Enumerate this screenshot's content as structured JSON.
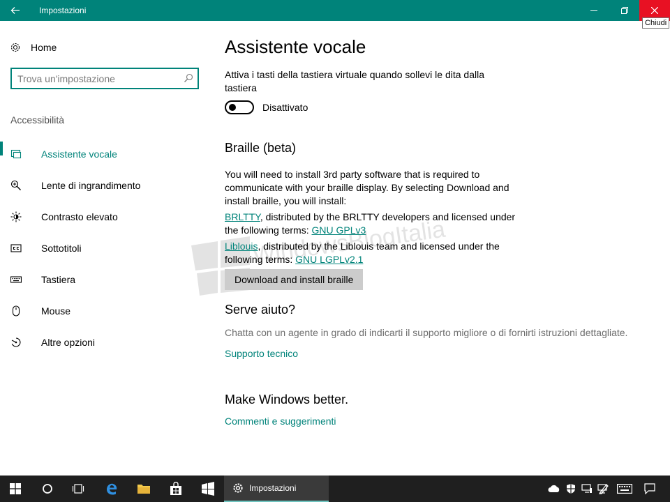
{
  "window": {
    "title": "Impostazioni",
    "close_tooltip": "Chiudi"
  },
  "nav": {
    "home_label": "Home",
    "search_placeholder": "Trova un'impostazione",
    "section_label": "Accessibilità",
    "items": [
      {
        "label": "Assistente vocale",
        "icon": "narrator-icon",
        "active": true
      },
      {
        "label": "Lente di ingrandimento",
        "icon": "magnifier-icon"
      },
      {
        "label": "Contrasto elevato",
        "icon": "contrast-icon"
      },
      {
        "label": "Sottotitoli",
        "icon": "captions-icon"
      },
      {
        "label": "Tastiera",
        "icon": "keyboard-icon"
      },
      {
        "label": "Mouse",
        "icon": "mouse-icon"
      },
      {
        "label": "Altre opzioni",
        "icon": "other-options-icon"
      }
    ]
  },
  "main": {
    "title": "Assistente vocale",
    "touch_keyboard_desc": "Attiva i tasti della tastiera virtuale quando sollevi le dita dalla tastiera",
    "toggle_state": "Disattivato",
    "braille": {
      "heading": "Braille (beta)",
      "intro": "You will need to install 3rd party software that is required to communicate with your braille display. By selecting Download and install braille, you will install:",
      "brltty_link": "BRLTTY",
      "brltty_text": ", distributed by the BRLTTY developers and licensed under the following terms:",
      "brltty_license": "GNU GPLv3",
      "liblouis_link": "Liblouis",
      "liblouis_text": ", distributed by the Liblouis team and licensed under the following terms:",
      "liblouis_license": "GNU LGPLv2.1",
      "button": "Download and install braille"
    },
    "help": {
      "heading": "Serve aiuto?",
      "text": "Chatta con un agente in grado di indicarti il supporto migliore o di fornirti istruzioni dettagliate.",
      "link": "Supporto tecnico"
    },
    "feedback": {
      "heading": "Make Windows better.",
      "link": "Commenti e suggerimenti"
    }
  },
  "watermark": {
    "text": "WindowsBlogItalia"
  },
  "taskbar": {
    "active_app": "Impostazioni"
  },
  "colors": {
    "accent": "#00837a",
    "close": "#e81123",
    "taskbar": "#1f1f1f"
  }
}
